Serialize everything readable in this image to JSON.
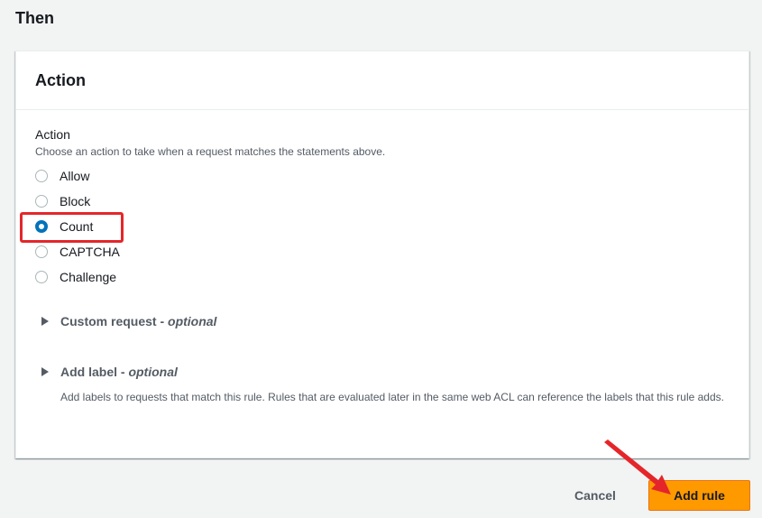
{
  "section": {
    "title": "Then"
  },
  "panel": {
    "title": "Action",
    "field_label": "Action",
    "field_description": "Choose an action to take when a request matches the statements above.",
    "options": [
      {
        "label": "Allow",
        "selected": false
      },
      {
        "label": "Block",
        "selected": false
      },
      {
        "label": "Count",
        "selected": true
      },
      {
        "label": "CAPTCHA",
        "selected": false
      },
      {
        "label": "Challenge",
        "selected": false
      }
    ],
    "custom_request": {
      "title": "Custom request - ",
      "optional": "optional"
    },
    "add_label": {
      "title": "Add label - ",
      "optional": "optional",
      "description": "Add labels to requests that match this rule. Rules that are evaluated later in the same web ACL can reference the labels that this rule adds."
    }
  },
  "footer": {
    "cancel_label": "Cancel",
    "submit_label": "Add rule"
  },
  "colors": {
    "accent": "#0073bb",
    "primary_button": "#ff9900",
    "annotation": "#e4262a"
  }
}
